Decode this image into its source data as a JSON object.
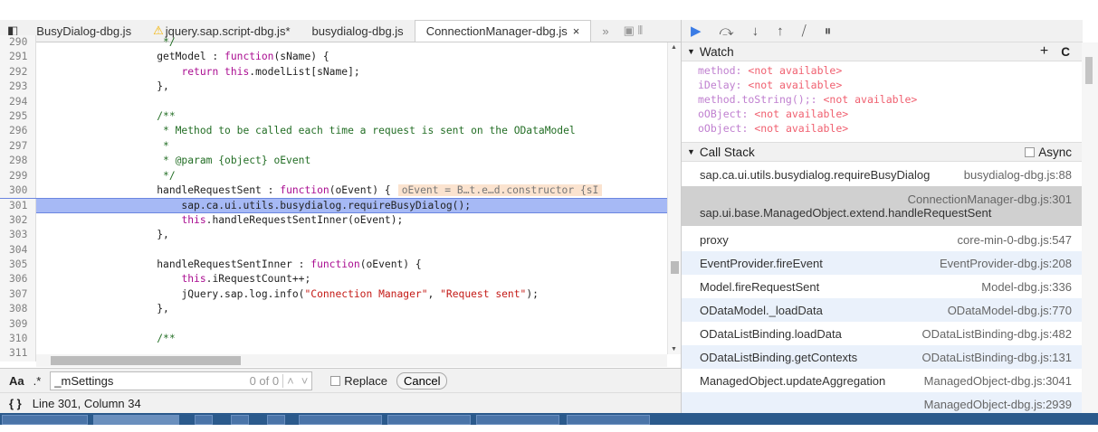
{
  "tabs": [
    {
      "label": "BusyDialog-dbg.js"
    },
    {
      "label": "jquery.sap.script-dbg.js*",
      "warning": true
    },
    {
      "label": "busydialog-dbg.js"
    },
    {
      "label": "ConnectionManager-dbg.js",
      "active": true
    }
  ],
  "tabs_overflow": "»",
  "close_glyph": "×",
  "code_lines": [
    {
      "n": "290",
      "t": [
        [
          "cm",
          "                    */"
        ]
      ]
    },
    {
      "n": "291",
      "t": [
        [
          "",
          "                   getModel : "
        ],
        [
          "kw",
          "function"
        ],
        [
          "",
          "(sName) {"
        ]
      ]
    },
    {
      "n": "292",
      "t": [
        [
          "",
          "                       "
        ],
        [
          "kw",
          "return this"
        ],
        [
          "",
          ".modelList[sName];"
        ]
      ]
    },
    {
      "n": "293",
      "t": [
        [
          "",
          "                   },"
        ]
      ]
    },
    {
      "n": "294",
      "t": []
    },
    {
      "n": "295",
      "t": [
        [
          "cm",
          "                   /**"
        ]
      ]
    },
    {
      "n": "296",
      "t": [
        [
          "cm",
          "                    * Method to be called each time a request is sent on the ODataModel"
        ]
      ]
    },
    {
      "n": "297",
      "t": [
        [
          "cm",
          "                    *"
        ]
      ]
    },
    {
      "n": "298",
      "t": [
        [
          "cm",
          "                    * @param {object} oEvent"
        ]
      ]
    },
    {
      "n": "299",
      "t": [
        [
          "cm",
          "                    */"
        ]
      ]
    },
    {
      "n": "300",
      "t": [
        [
          "",
          "                   handleRequestSent : "
        ],
        [
          "kw",
          "function"
        ],
        [
          "",
          "(oEvent) {"
        ]
      ],
      "inline": "oEvent = B…t.e…d.constructor {sI"
    },
    {
      "n": "301",
      "t": [
        [
          "",
          "                       sap.ca.ui.utils.busydialog.requireBusyDialog();"
        ]
      ],
      "exec": true
    },
    {
      "n": "302",
      "t": [
        [
          "",
          "                       "
        ],
        [
          "kw",
          "this"
        ],
        [
          "",
          ".handleRequestSentInner(oEvent);"
        ]
      ]
    },
    {
      "n": "303",
      "t": [
        [
          "",
          "                   },"
        ]
      ]
    },
    {
      "n": "304",
      "t": []
    },
    {
      "n": "305",
      "t": [
        [
          "",
          "                   handleRequestSentInner : "
        ],
        [
          "kw",
          "function"
        ],
        [
          "",
          "(oEvent) {"
        ]
      ]
    },
    {
      "n": "306",
      "t": [
        [
          "",
          "                       "
        ],
        [
          "kw",
          "this"
        ],
        [
          "",
          ".iRequestCount++;"
        ]
      ]
    },
    {
      "n": "307",
      "t": [
        [
          "",
          "                       jQuery.sap.log.info("
        ],
        [
          "str",
          "\"Connection Manager\""
        ],
        [
          "",
          ", "
        ],
        [
          "str",
          "\"Request sent\""
        ],
        [
          "",
          ");"
        ]
      ]
    },
    {
      "n": "308",
      "t": [
        [
          "",
          "                   },"
        ]
      ]
    },
    {
      "n": "309",
      "t": []
    },
    {
      "n": "310",
      "t": [
        [
          "cm",
          "                   /**"
        ]
      ]
    },
    {
      "n": "311",
      "t": []
    }
  ],
  "search": {
    "case_label": "Aa",
    "regex_label": ".*",
    "value": "_mSettings",
    "count": "0 of 0",
    "replace_label": "Replace",
    "cancel_label": "Cancel"
  },
  "status": {
    "pretty_print": "{ }",
    "position": "Line 301, Column 34"
  },
  "watch": {
    "title": "Watch",
    "add": "+",
    "refresh": "C",
    "items": [
      {
        "name": "method",
        "value": "<not available>"
      },
      {
        "name": "iDelay",
        "value": "<not available>"
      },
      {
        "name": "method.toString();",
        "value": "<not available>"
      },
      {
        "name": "oOBject",
        "value": "<not available>"
      },
      {
        "name": "oObject",
        "value": "<not available>"
      }
    ]
  },
  "callstack": {
    "title": "Call Stack",
    "async_label": "Async",
    "frames": [
      {
        "fn": "sap.ca.ui.utils.busydialog.requireBusyDialog",
        "loc": "busydialog-dbg.js:88"
      },
      {
        "fn": "sap.ui.base.ManagedObject.extend.handleRequestSent",
        "loc": "ConnectionManager-dbg.js:301",
        "selected": true
      },
      {
        "fn": "proxy",
        "loc": "core-min-0-dbg.js:547"
      },
      {
        "fn": "EventProvider.fireEvent",
        "loc": "EventProvider-dbg.js:208"
      },
      {
        "fn": "Model.fireRequestSent",
        "loc": "Model-dbg.js:336"
      },
      {
        "fn": "ODataModel._loadData",
        "loc": "ODataModel-dbg.js:770"
      },
      {
        "fn": "ODataListBinding.loadData",
        "loc": "ODataListBinding-dbg.js:482"
      },
      {
        "fn": "ODataListBinding.getContexts",
        "loc": "ODataListBinding-dbg.js:131"
      },
      {
        "fn": "ManagedObject.updateAggregation",
        "loc": "ManagedObject-dbg.js:3041"
      },
      {
        "fn": "",
        "loc": "ManagedObject-dbg.js:2939"
      }
    ]
  }
}
